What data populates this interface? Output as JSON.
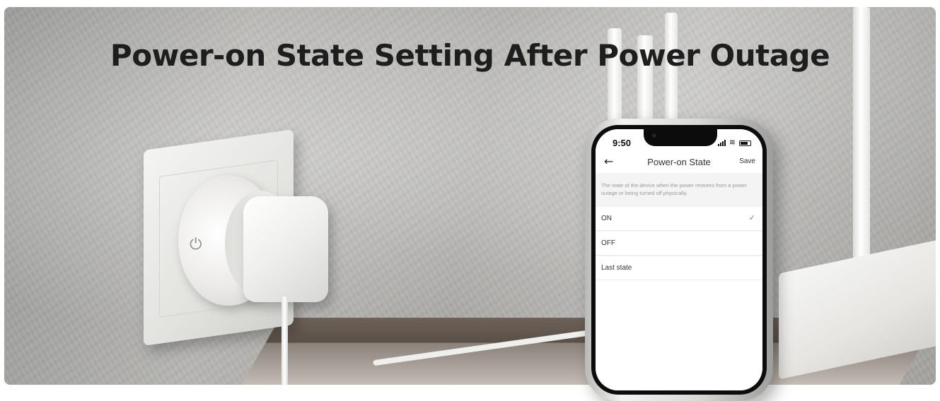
{
  "banner": {
    "title": "Power-on State Setting After Power Outage"
  },
  "phone": {
    "status_bar": {
      "time": "9:50"
    },
    "nav": {
      "title": "Power-on State",
      "save_label": "Save",
      "back_icon": "arrow-left-icon"
    },
    "description": "The state of the device when the power restores from a power outage or being turned off physically.",
    "options": [
      {
        "label": "ON",
        "selected": true
      },
      {
        "label": "OFF",
        "selected": false
      },
      {
        "label": "Last state",
        "selected": false
      }
    ],
    "accent_color": "#4b8ef5"
  },
  "icons": {
    "plug_power": "power-icon",
    "check": "check-icon",
    "wifi": "wifi-icon",
    "signal": "signal-icon",
    "battery": "battery-icon"
  }
}
